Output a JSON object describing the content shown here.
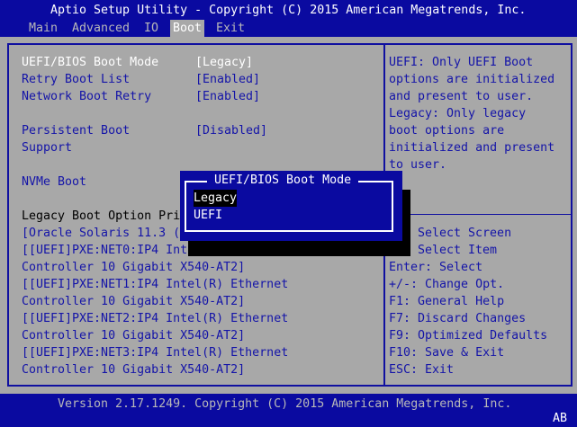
{
  "title": "Aptio Setup Utility - Copyright (C) 2015 American Megatrends, Inc.",
  "tabs": [
    {
      "label": "Main"
    },
    {
      "label": "Advanced"
    },
    {
      "label": "IO"
    },
    {
      "label": "Boot",
      "active": true
    },
    {
      "label": "Exit"
    }
  ],
  "settings": [
    {
      "label": "UEFI/BIOS Boot Mode",
      "value": "[Legacy]"
    },
    {
      "label": "Retry Boot List",
      "value": "[Enabled]"
    },
    {
      "label": "Network Boot Retry",
      "value": "[Enabled]"
    },
    {
      "label": "Persistent Boot",
      "label2": "Support",
      "value": "[Disabled]"
    },
    {
      "label": "NVMe Boot"
    }
  ],
  "legacy_heading": "Legacy Boot Option Pri",
  "boot_options": [
    "[Oracle Solaris 11.3 (",
    "[[UEFI]PXE:NET0:IP4 Intel",
    "Controller 10 Gigabit X540-AT2]",
    "[[UEFI]PXE:NET1:IP4 Intel(R) Ethernet",
    "Controller 10 Gigabit X540-AT2]",
    "[[UEFI]PXE:NET2:IP4 Intel(R) Ethernet",
    "Controller 10 Gigabit X540-AT2]",
    "[[UEFI]PXE:NET3:IP4 Intel(R) Ethernet",
    "Controller 10 Gigabit X540-AT2]"
  ],
  "help_text": [
    "UEFI: Only UEFI Boot",
    "options are initialized",
    "and present to user.",
    "Legacy: Only legacy",
    "boot options are",
    "initialized and present",
    "to user."
  ],
  "keys": [
    "Select Screen",
    "Select Item",
    "Enter: Select",
    "+/-: Change Opt.",
    "F1: General Help",
    "F7: Discard Changes",
    "F9: Optimized Defaults",
    "F10: Save & Exit",
    "ESC: Exit"
  ],
  "popup": {
    "title": "UEFI/BIOS Boot Mode",
    "options": [
      "Legacy",
      "UEFI"
    ],
    "selected": "Legacy"
  },
  "footer": {
    "version": "Version 2.17.1249. Copyright (C) 2015 American Megatrends, Inc.",
    "badge": "AB"
  },
  "colors": {
    "blue": "#0a0aa0",
    "gray": "#a8a8a8"
  }
}
